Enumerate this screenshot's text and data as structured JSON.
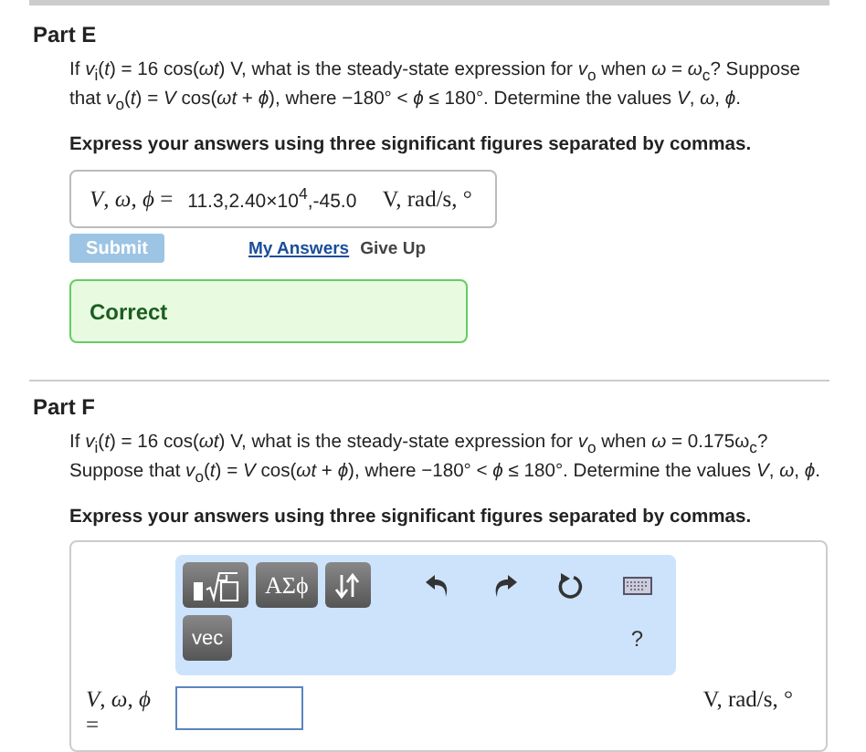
{
  "parts": [
    {
      "title": "Part E",
      "question": "If *v*$_{i}$(*t*) = 16 cos(*ωt*) V, what is the steady-state expression for *v*$_{o}$ when *ω* = *ω*$_{c}$? Suppose that *v*$_{o}$(*t*) = *V* cos(*ωt* + *ϕ*), where −180° < *ϕ* ≤ 180°. Determine the values *V*, *ω*, *ϕ*.",
      "instruction": "Express your answers using three significant figures separated by commas.",
      "answer": {
        "label": "*V*, *ω*, *ϕ* =",
        "value": "11.3,2.40×10$^{4}$,-45.0",
        "units": "V, rad/s, °"
      },
      "submit": {
        "label": "Submit",
        "disabled": true
      },
      "links": [
        "My Answers",
        "Give Up"
      ],
      "feedback": {
        "kind": "correct",
        "text": "Correct"
      }
    },
    {
      "title": "Part F",
      "question": "If *v*$_{i}$(*t*) = 16 cos(*ωt*) V, what is the steady-state expression for *v*$_{o}$ when *ω* = 0.175ω$_{c}$? Suppose that *v*$_{o}$(*t*) = *V* cos(*ωt* + *ϕ*), where −180° < *ϕ* ≤ 180°. Determine the values *V*, *ω*, *ϕ*.",
      "instruction": "Express your answers using three significant figures separated by commas.",
      "editor": {
        "symbols_button": "ΑΣϕ",
        "vec_button": "vec",
        "help_button": "?",
        "label": "*V*, *ω*, *ϕ* =",
        "units": "V, rad/s, °"
      }
    }
  ]
}
